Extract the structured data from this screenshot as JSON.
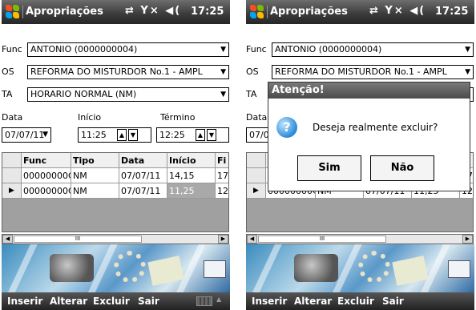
{
  "app": {
    "title": "Apropriações",
    "clock": "17:25",
    "status_icons": "⇄ Y× ◀("
  },
  "form": {
    "func_label": "Func",
    "func_value": "ANTONIO (0000000004)",
    "os_label": "OS",
    "os_value": "REFORMA DO MISTURDOR No.1 - AMPL",
    "ta_label": "TA",
    "ta_value": "HORARIO NORMAL (NM)",
    "data_label": "Data",
    "inicio_label": "Início",
    "termino_label": "Término",
    "date_value": "07/07/11",
    "start_value": "11:25",
    "end_value": "12:25"
  },
  "grid": {
    "headers": [
      "Func",
      "Tipo",
      "Data",
      "Início",
      "Fi"
    ],
    "rows": [
      [
        "00000000C",
        "NM",
        "07/07/11",
        "14,15",
        "17"
      ],
      [
        "00000000C",
        "NM",
        "07/07/11",
        "11,25",
        "12"
      ]
    ],
    "scroll_thumb": "III"
  },
  "menu": {
    "inserir": "Inserir",
    "alterar": "Alterar",
    "excluir": "Excluir",
    "sair": "Sair"
  },
  "dialog": {
    "title": "Atenção!",
    "message": "Deseja realmente excluir?",
    "yes": "Sim",
    "no": "Não"
  },
  "icons": {
    "windows": "windows-flag-icon",
    "question": "question-icon",
    "keyboard": "keyboard-icon"
  },
  "colors": {
    "titlebar": "#3a3a3a",
    "selected_cell": "#a9a9a9"
  }
}
